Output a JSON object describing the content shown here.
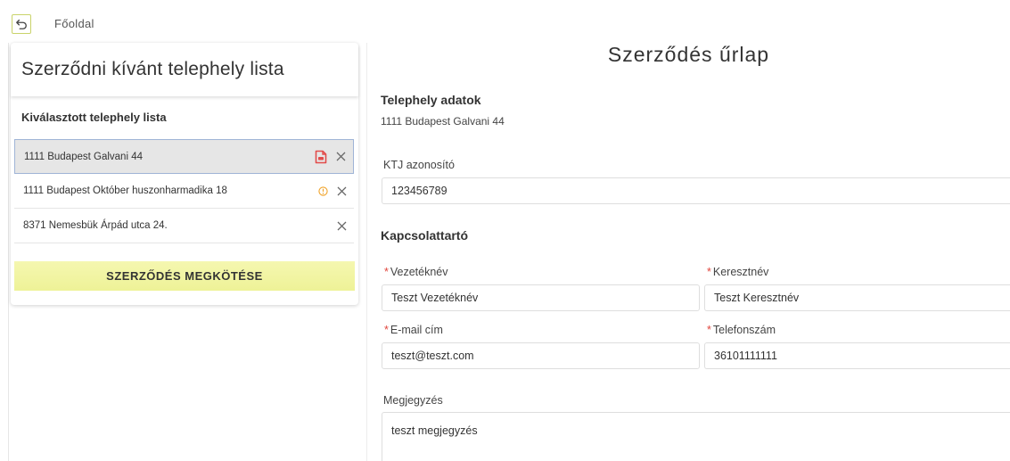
{
  "nav": {
    "back_icon": "undo-arrow-icon",
    "breadcrumb": "Főoldal"
  },
  "sidebar": {
    "title": "Szerződni kívánt telephely lista",
    "subtitle": "Kiválasztott telephely lista",
    "items": [
      {
        "address": "1111 Budapest Galvani 44",
        "status_icon": "pdf-document-icon",
        "selected": true
      },
      {
        "address": "1111 Budapest Október huszonharmadika 18",
        "status_icon": "info-warning-icon",
        "selected": false
      },
      {
        "address": "8371 Nemesbük Árpád utca 24.",
        "status_icon": "",
        "selected": false
      }
    ],
    "contract_button": "SZERZŐDÉS MEGKÖTÉSE"
  },
  "form": {
    "title": "Szerződés űrlap",
    "site_section": "Telephely adatok",
    "site_address": "1111 Budapest Galvani 44",
    "ktj_label": "KTJ azonosító",
    "ktj_value": "123456789",
    "contact_section": "Kapcsolattartó",
    "required_mark": "*",
    "last_name_label": "Vezetéknév",
    "last_name_value": "Teszt Vezetéknév",
    "first_name_label": "Keresztnév",
    "first_name_value": "Teszt Keresztnév",
    "email_label": "E-mail cím",
    "email_value": "teszt@teszt.com",
    "phone_label": "Telefonszám",
    "phone_value": "36101111111",
    "note_label": "Megjegyzés",
    "note_value": "teszt megjegyzés"
  },
  "colors": {
    "accent_yellow": "#f0f39e",
    "pdf_red": "#e24c4b",
    "info_orange": "#f0a32a",
    "required_red": "#e0453c",
    "selected_border": "#9fb4d6"
  }
}
